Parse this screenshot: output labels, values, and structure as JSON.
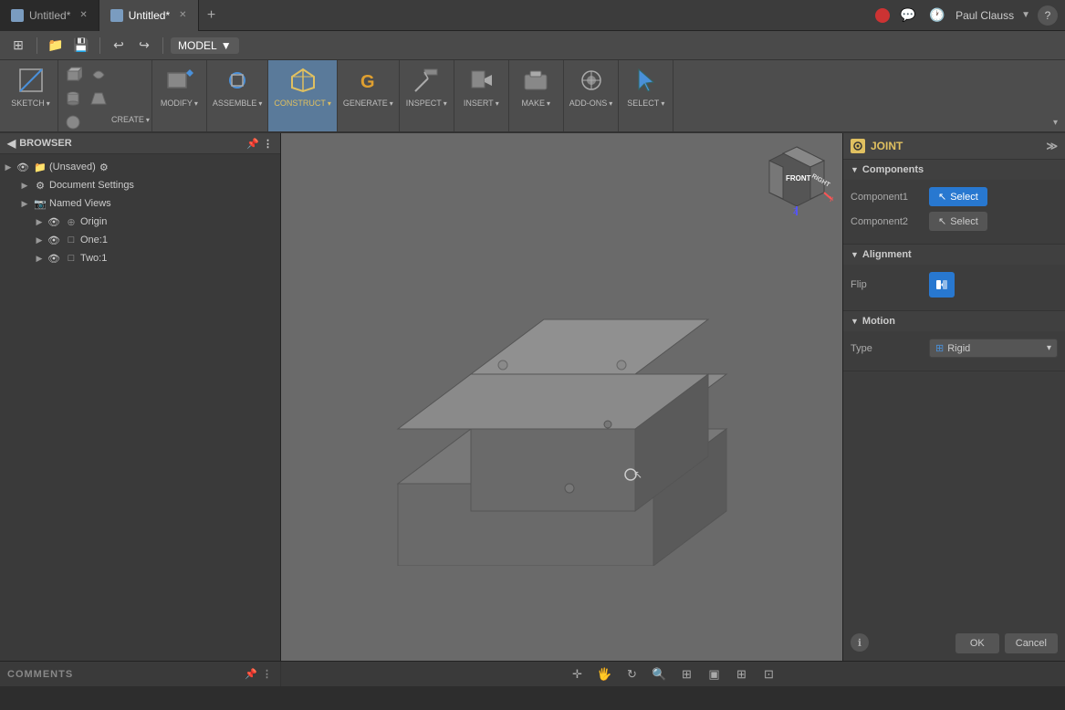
{
  "tabs": [
    {
      "label": "Untitled*",
      "active": false,
      "icon": "cube-icon"
    },
    {
      "label": "Untitled*",
      "active": true,
      "icon": "cube-icon"
    }
  ],
  "toolbar": {
    "model_label": "MODEL",
    "sketch_label": "SKETCH",
    "create_label": "CREATE",
    "modify_label": "MODIFY",
    "assemble_label": "ASSEMBLE",
    "construct_label": "CONSTRUCT",
    "generate_label": "GENERATE",
    "inspect_label": "INSPECT",
    "insert_label": "INSERT",
    "make_label": "MAKE",
    "add_ons_label": "ADD-ONS",
    "select_label": "SELECT"
  },
  "browser": {
    "title": "BROWSER",
    "items": [
      {
        "label": "(Unsaved)",
        "indent": 0,
        "type": "root",
        "has_arrow": true,
        "badge": true
      },
      {
        "label": "Document Settings",
        "indent": 1,
        "type": "settings",
        "has_arrow": true
      },
      {
        "label": "Named Views",
        "indent": 1,
        "type": "folder",
        "has_arrow": true
      },
      {
        "label": "Origin",
        "indent": 2,
        "type": "origin",
        "has_arrow": true
      },
      {
        "label": "One:1",
        "indent": 2,
        "type": "component",
        "has_arrow": true
      },
      {
        "label": "Two:1",
        "indent": 2,
        "type": "component",
        "has_arrow": true
      }
    ]
  },
  "joint_panel": {
    "title": "JOINT",
    "sections": {
      "components": {
        "label": "Components",
        "component1_label": "Component1",
        "component1_btn": "Select",
        "component2_label": "Component2",
        "component2_btn": "Select"
      },
      "alignment": {
        "label": "Alignment",
        "flip_label": "Flip"
      },
      "motion": {
        "label": "Motion",
        "type_label": "Type",
        "type_value": "Rigid"
      }
    },
    "ok_label": "OK",
    "cancel_label": "Cancel"
  },
  "bottom": {
    "comments_label": "COMMENTS"
  },
  "user": {
    "name": "Paul Clauss"
  },
  "axis": {
    "front": "FRONT",
    "right": "RIGHT"
  }
}
